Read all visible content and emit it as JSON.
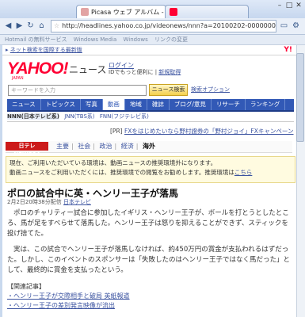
{
  "browser": {
    "tabs": [
      {
        "label": "Picasa ウェブ アルバム - ma..."
      },
      {
        "label": ""
      }
    ],
    "url": "http://headlines.yahoo.co.jp/videonews/nnn?a=20100202-00000000-nnn-int",
    "bookmarks": [
      "Hotmail の無料サービス",
      "Windows Media",
      "Windows",
      "リンクの変更"
    ]
  },
  "page": {
    "top_link": "ネット検索を国際する最新版",
    "logo": "YAHOO!",
    "logo_sub": "JAPAN",
    "section": "ニュース",
    "login": "ログイン",
    "login_text": "IDでもっと便利に",
    "signup": "新規取得",
    "search_placeholder": "キーワードを入力",
    "search_button": "ニュース検索",
    "search_option": "検索オプション",
    "menu": [
      "ニュース",
      "トピックス",
      "写真",
      "動画",
      "地域",
      "雑誌",
      "ブログ/意見",
      "リサーチ",
      "ランキング"
    ],
    "active_menu": 3,
    "submenu": [
      "NNN(日本テレビ系)",
      "JNN(TBS系)",
      "FNN(フジテレビ系)"
    ],
    "pr_label": "[PR]",
    "pr_text": "FXをはじめたいなら野村證券の「野村ジョイ」FXキャンペーン",
    "ntv_logo": "日テレNEWS24",
    "ntv_tabs": [
      "主要",
      "社会",
      "政治",
      "経済",
      "海外"
    ],
    "notice_line1": "現在、ご利用いただいている環境は、動画ニュースの推奨環境外になります。",
    "notice_line2": "動画ニュースをご利用いただくには、推奨環境での閲覧をお勧めします。推奨環境は",
    "notice_link": "こちら",
    "headline": "ポロの試合中に英・ヘンリー王子が落馬",
    "date": "2月2日20時38分配信",
    "source": "日本テレビ",
    "body1": "ポロのチャリティー試合に参加したイギリス・ヘンリー王子が、ボールを打とうとしたところ、馬が足をすべらせて落馬した。ヘンリー王子は怒りを抑えることができず、スティックを投げ捨てた。",
    "body2": "実は、この試合でヘンリー王子が落馬しなければ、約450万円の賞金が支払われるはずだった。しかし、このイベントのスポンサーは「失敗したのはヘンリー王子ではなく馬だった」として、最終的に賞金を支払ったという。",
    "related_title": "【関連記事】",
    "related": [
      "ヘンリー王子が交際相手と破局 英紙報道",
      "ヘンリー王子の差別発言映像が流出"
    ]
  }
}
